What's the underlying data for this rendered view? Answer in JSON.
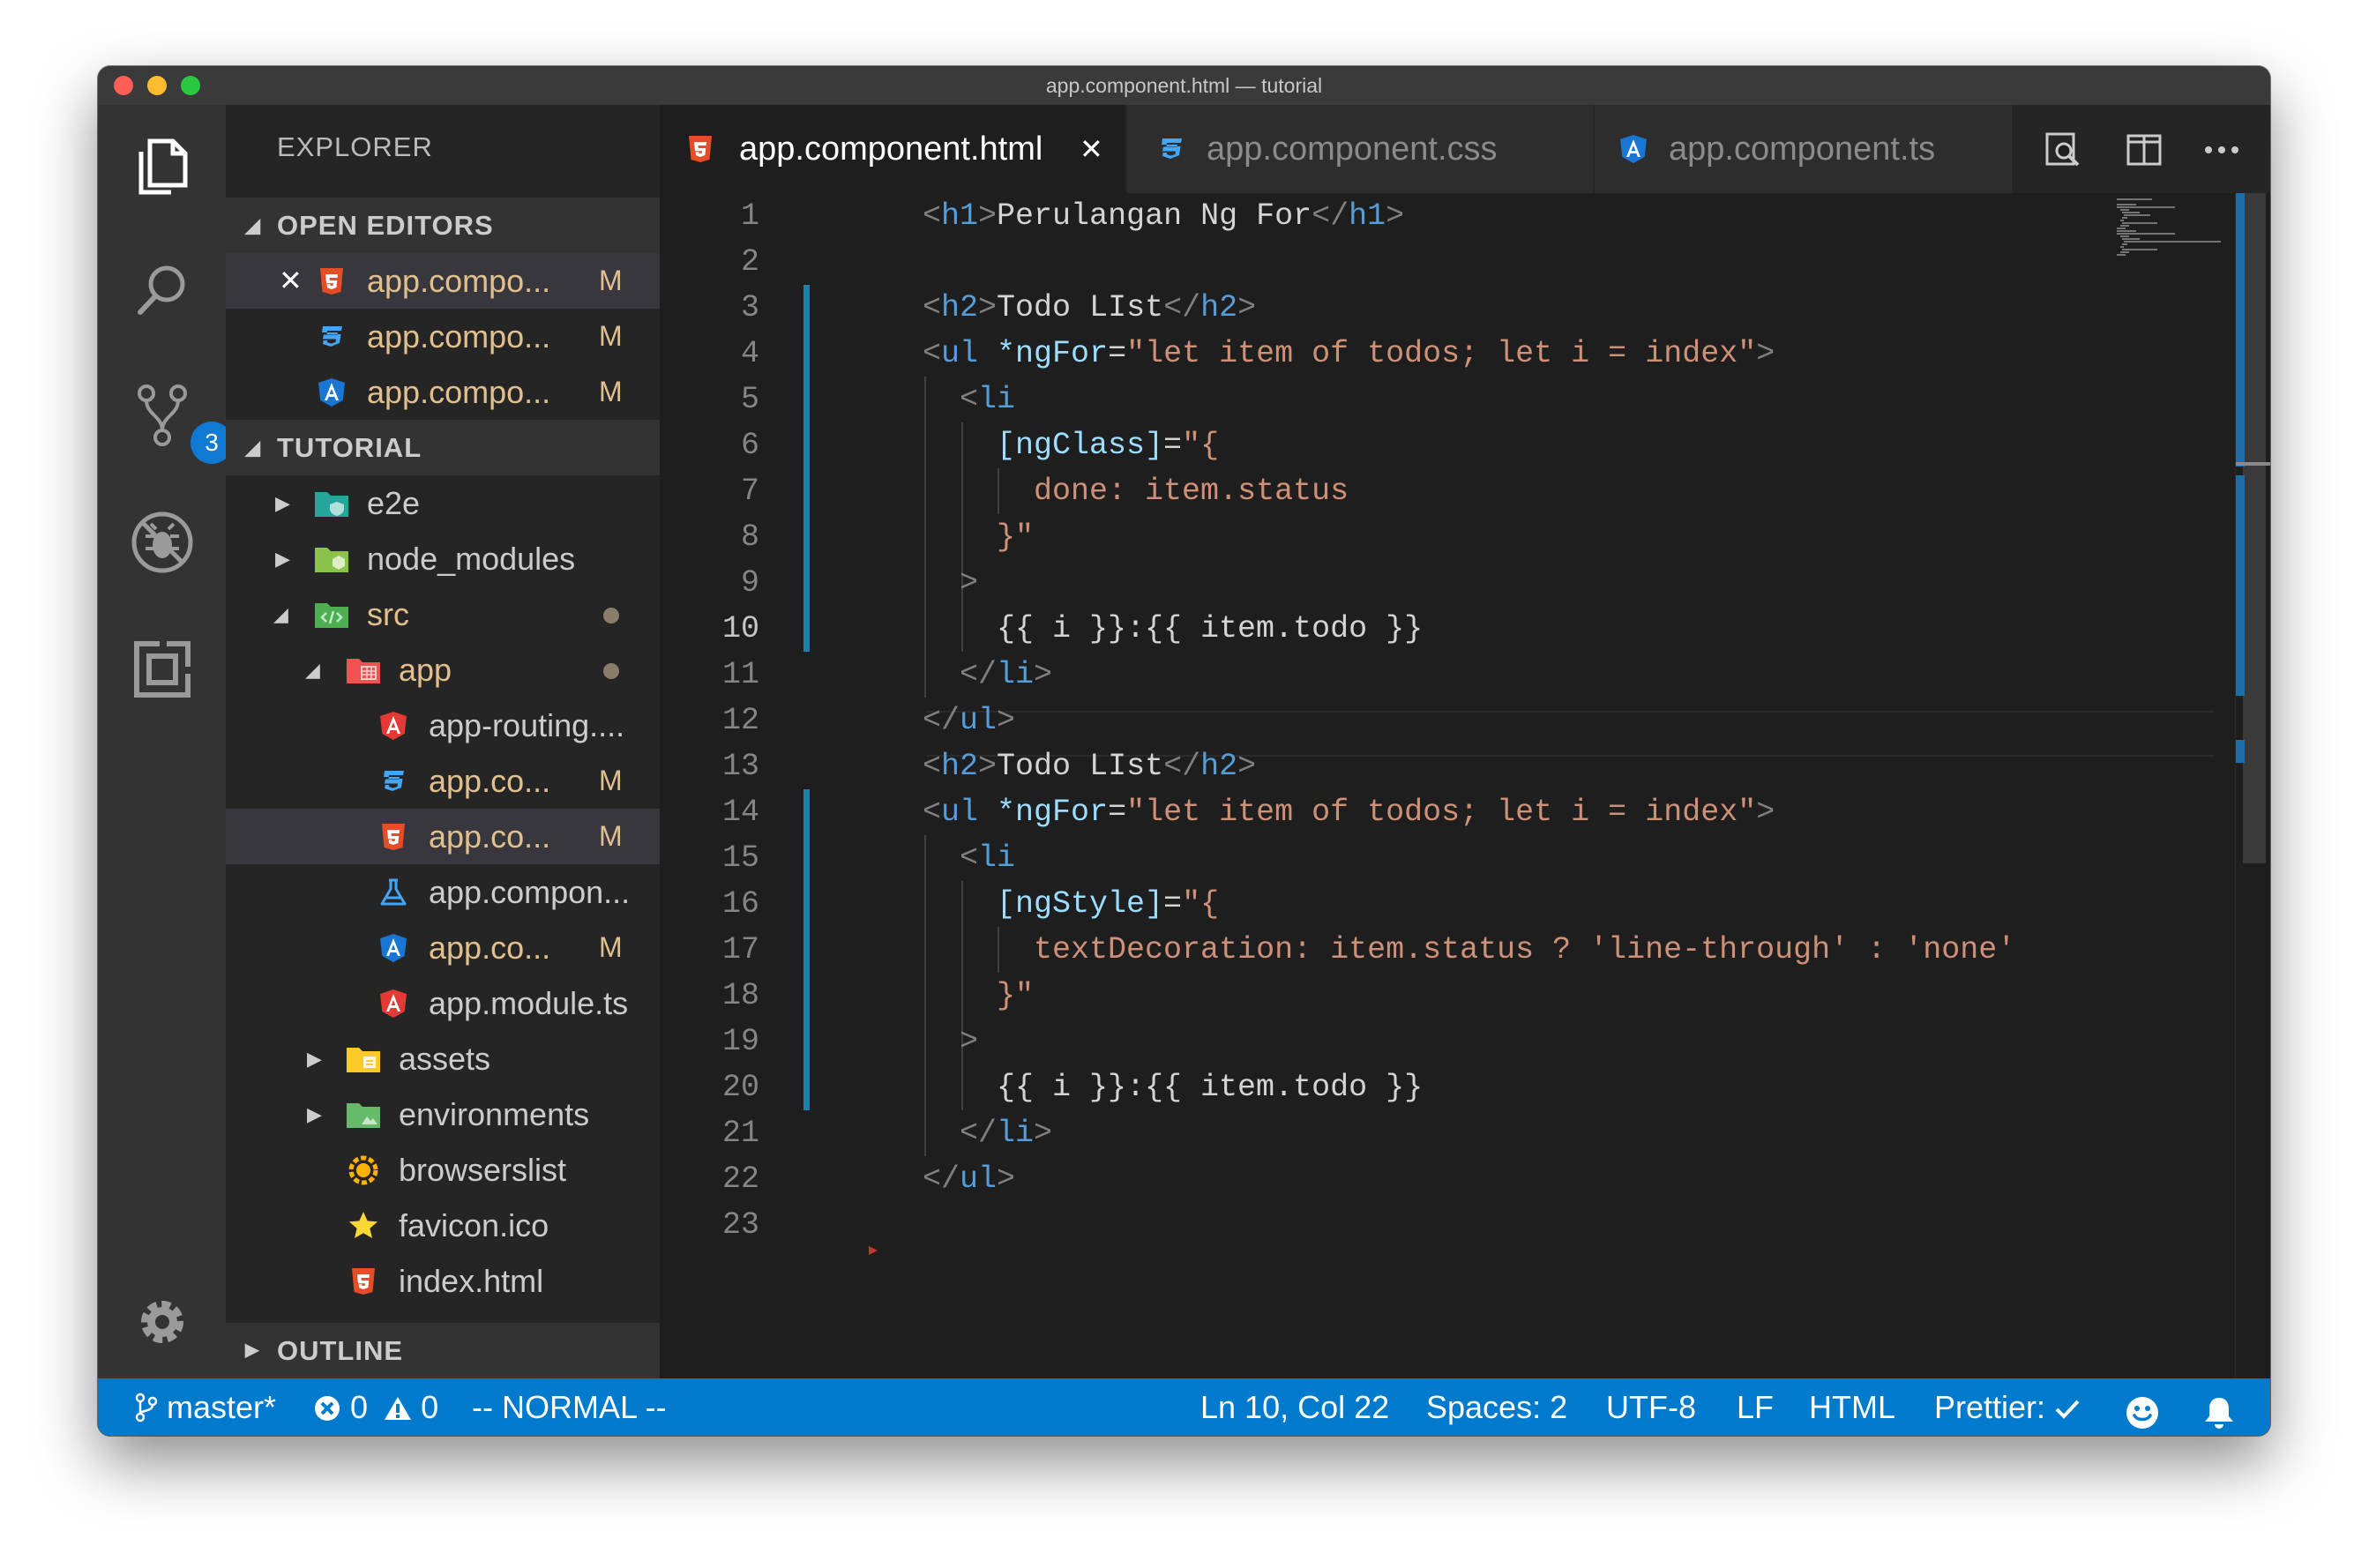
{
  "window": {
    "title": "app.component.html — tutorial",
    "traffic_lights": [
      "#ff5f57",
      "#febc2e",
      "#28c840"
    ]
  },
  "activity_bar": {
    "items": [
      {
        "name": "explorer",
        "icon": "files-icon"
      },
      {
        "name": "search",
        "icon": "search-icon"
      },
      {
        "name": "source-control",
        "icon": "source-control-icon",
        "badge": "3"
      },
      {
        "name": "debug",
        "icon": "debug-icon"
      },
      {
        "name": "extensions",
        "icon": "extensions-icon"
      }
    ],
    "settings_icon": "gear-icon"
  },
  "sidebar": {
    "title": "EXPLORER",
    "open_editors": {
      "header": "OPEN EDITORS",
      "items": [
        {
          "name": "app.compo...",
          "status": "M",
          "icon": "html5-icon",
          "active": true
        },
        {
          "name": "app.compo...",
          "status": "M",
          "icon": "css3-icon"
        },
        {
          "name": "app.compo...",
          "status": "M",
          "icon": "angular-icon"
        }
      ]
    },
    "project": {
      "header": "TUTORIAL",
      "items": [
        {
          "name": "e2e",
          "icon": "folder-e2e-icon"
        },
        {
          "name": "node_modules",
          "icon": "folder-node-icon"
        },
        {
          "name": "src",
          "icon": "folder-src-icon"
        },
        {
          "name": "app",
          "icon": "folder-app-icon"
        },
        {
          "name": "app-routing....",
          "icon": "angular-red-icon"
        },
        {
          "name": "app.co...",
          "status": "M",
          "icon": "css3-icon"
        },
        {
          "name": "app.co...",
          "status": "M",
          "icon": "html5-icon"
        },
        {
          "name": "app.compon...",
          "icon": "flask-icon"
        },
        {
          "name": "app.co...",
          "status": "M",
          "icon": "angular-icon"
        },
        {
          "name": "app.module.ts",
          "icon": "angular-red-icon"
        },
        {
          "name": "assets",
          "icon": "folder-assets-icon"
        },
        {
          "name": "environments",
          "icon": "folder-env-icon"
        },
        {
          "name": "browserslist",
          "icon": "browserslist-icon"
        },
        {
          "name": "favicon.ico",
          "icon": "star-icon"
        },
        {
          "name": "index.html",
          "icon": "html5-icon"
        }
      ]
    },
    "outline": {
      "header": "OUTLINE"
    }
  },
  "tabs": [
    {
      "label": "app.component.html",
      "icon": "html5-icon",
      "active": true
    },
    {
      "label": "app.component.css",
      "icon": "css3-icon"
    },
    {
      "label": "app.component.ts",
      "icon": "angular-icon"
    }
  ],
  "editor": {
    "current_line": 10,
    "lines": [
      [
        [
          "t",
          "<"
        ],
        [
          "tn",
          "h1"
        ],
        [
          "t",
          ">"
        ],
        [
          "x",
          "Perulangan Ng For"
        ],
        [
          "t",
          "</"
        ],
        [
          "tn",
          "h1"
        ],
        [
          "t",
          ">"
        ]
      ],
      [],
      [
        [
          "t",
          "<"
        ],
        [
          "tn",
          "h2"
        ],
        [
          "t",
          ">"
        ],
        [
          "x",
          "Todo LIst"
        ],
        [
          "t",
          "</"
        ],
        [
          "tn",
          "h2"
        ],
        [
          "t",
          ">"
        ]
      ],
      [
        [
          "t",
          "<"
        ],
        [
          "tn",
          "ul"
        ],
        [
          "x",
          " "
        ],
        [
          "at",
          "*ngFor"
        ],
        [
          "x",
          "="
        ],
        [
          "sv",
          "\"let item of todos; let i = index\""
        ],
        [
          "t",
          ">"
        ]
      ],
      [
        [
          "x",
          "  "
        ],
        [
          "t",
          "<"
        ],
        [
          "tn",
          "li"
        ]
      ],
      [
        [
          "x",
          "    "
        ],
        [
          "at",
          "[ngClass]"
        ],
        [
          "x",
          "="
        ],
        [
          "sv",
          "\"{"
        ]
      ],
      [
        [
          "x",
          "      "
        ],
        [
          "sv",
          "done: item.status"
        ]
      ],
      [
        [
          "x",
          "    "
        ],
        [
          "sv",
          "}\""
        ]
      ],
      [
        [
          "x",
          "  "
        ],
        [
          "t",
          ">"
        ]
      ],
      [
        [
          "x",
          "    {{ i }}:{{ item.todo }}"
        ]
      ],
      [
        [
          "x",
          "  "
        ],
        [
          "t",
          "</"
        ],
        [
          "tn",
          "li"
        ],
        [
          "t",
          ">"
        ]
      ],
      [
        [
          "t",
          "</"
        ],
        [
          "tn",
          "ul"
        ],
        [
          "t",
          ">"
        ]
      ],
      [
        [
          "t",
          "<"
        ],
        [
          "tn",
          "h2"
        ],
        [
          "t",
          ">"
        ],
        [
          "x",
          "Todo LIst"
        ],
        [
          "t",
          "</"
        ],
        [
          "tn",
          "h2"
        ],
        [
          "t",
          ">"
        ]
      ],
      [
        [
          "t",
          "<"
        ],
        [
          "tn",
          "ul"
        ],
        [
          "x",
          " "
        ],
        [
          "at",
          "*ngFor"
        ],
        [
          "x",
          "="
        ],
        [
          "sv",
          "\"let item of todos; let i = index\""
        ],
        [
          "t",
          ">"
        ]
      ],
      [
        [
          "x",
          "  "
        ],
        [
          "t",
          "<"
        ],
        [
          "tn",
          "li"
        ]
      ],
      [
        [
          "x",
          "    "
        ],
        [
          "at",
          "[ngStyle]"
        ],
        [
          "x",
          "="
        ],
        [
          "sv",
          "\"{"
        ]
      ],
      [
        [
          "x",
          "      "
        ],
        [
          "sv",
          "textDecoration: item.status ? 'line-through' : 'none'"
        ]
      ],
      [
        [
          "x",
          "    "
        ],
        [
          "sv",
          "}\""
        ]
      ],
      [
        [
          "x",
          "  "
        ],
        [
          "t",
          ">"
        ]
      ],
      [
        [
          "x",
          "    {{ i }}:{{ item.todo }}"
        ]
      ],
      [
        [
          "x",
          "  "
        ],
        [
          "t",
          "</"
        ],
        [
          "tn",
          "li"
        ],
        [
          "t",
          ">"
        ]
      ],
      [
        [
          "t",
          "</"
        ],
        [
          "tn",
          "ul"
        ],
        [
          "t",
          ">"
        ]
      ],
      []
    ]
  },
  "status_bar": {
    "branch": "master*",
    "errors": "0",
    "warnings": "0",
    "mode": "-- NORMAL --",
    "position": "Ln 10, Col 22",
    "spaces": "Spaces: 2",
    "encoding": "UTF-8",
    "eol": "LF",
    "language": "HTML",
    "formatter": "Prettier:",
    "color": "#007acc"
  }
}
